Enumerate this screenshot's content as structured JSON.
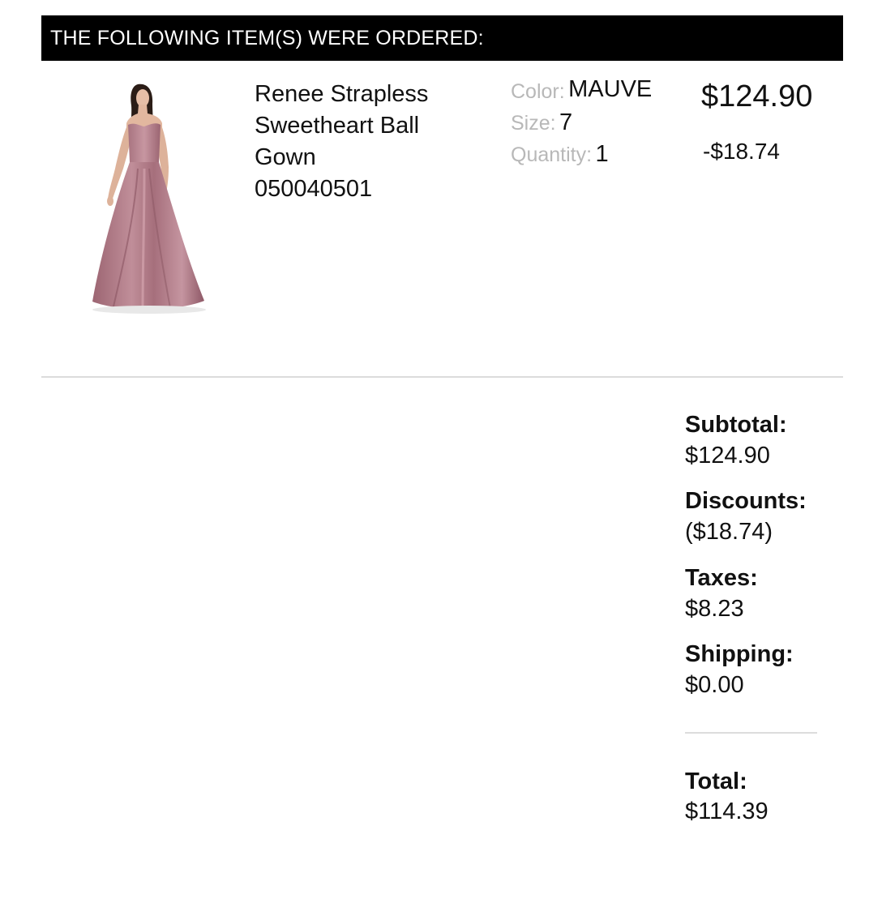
{
  "header": {
    "title": "THE FOLLOWING ITEM(S) WERE ORDERED:"
  },
  "item": {
    "image": {
      "alt": "model wearing mauve strapless ball gown",
      "color": "#b07a86"
    },
    "name_lines": [
      "Renee Strapless",
      "Sweetheart Ball",
      "Gown"
    ],
    "sku": "050040501",
    "attributes": [
      {
        "label": "Color:",
        "value": "MAUVE"
      },
      {
        "label": "Size:",
        "value": "7"
      },
      {
        "label": "Quantity:",
        "value": "1"
      }
    ],
    "price": "$124.90",
    "discount": "-$18.74"
  },
  "summary": {
    "subtotal": {
      "label": "Subtotal:",
      "value": "$124.90"
    },
    "discounts": {
      "label": "Discounts:",
      "value": "($18.74)"
    },
    "taxes": {
      "label": "Taxes:",
      "value": "$8.23"
    },
    "shipping": {
      "label": "Shipping:",
      "value": "$0.00"
    },
    "total": {
      "label": "Total:",
      "value": "$114.39"
    }
  }
}
